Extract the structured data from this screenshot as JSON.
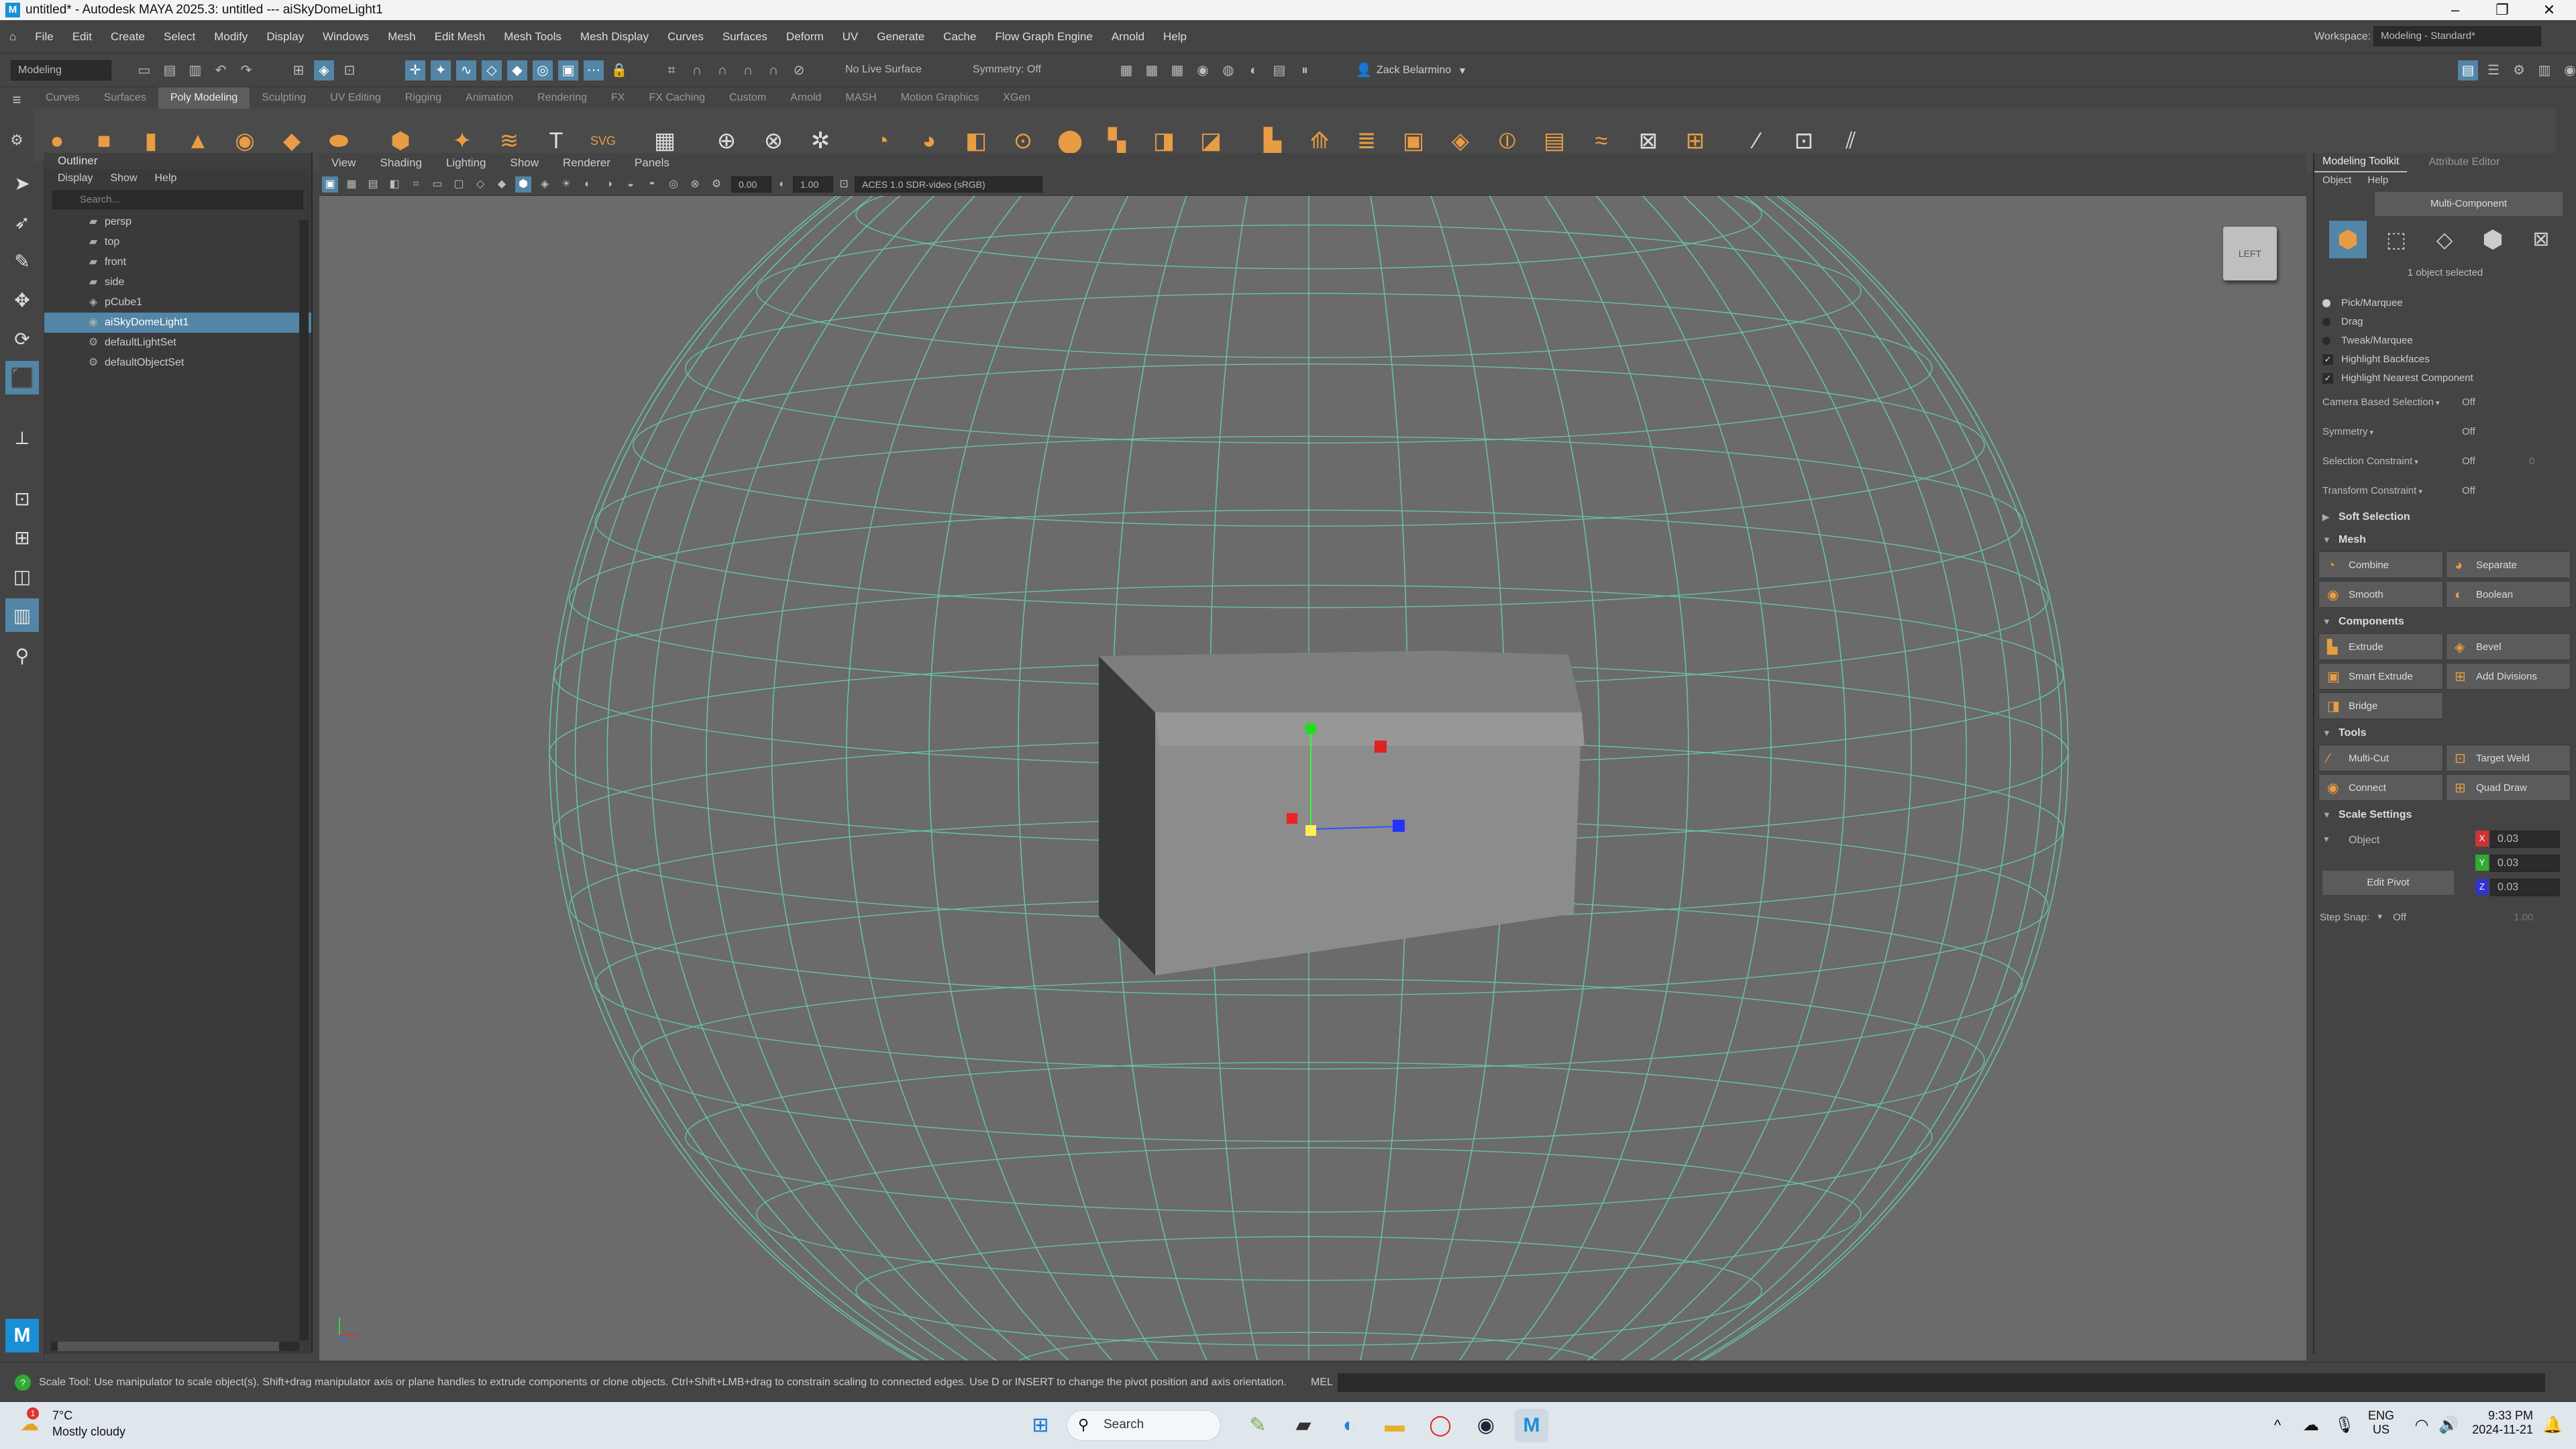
{
  "title": {
    "text": "untitled* - Autodesk MAYA 2025.3: untitled   ---   aiSkyDomeLight1",
    "logo_letter": "M",
    "min_icon": "minimize-icon",
    "max_icon": "maximize-icon",
    "close_icon": "close-icon"
  },
  "menubar": {
    "items": [
      "File",
      "Edit",
      "Create",
      "Select",
      "Modify",
      "Display",
      "Windows",
      "Mesh",
      "Edit Mesh",
      "Mesh Tools",
      "Mesh Display",
      "Curves",
      "Surfaces",
      "Deform",
      "UV",
      "Generate",
      "Cache",
      "Flow Graph Engine",
      "Arnold",
      "Help"
    ],
    "workspace_label": "Workspace:",
    "workspace_value": "Modeling - Standard*"
  },
  "statusline": {
    "mode": "Modeling",
    "live_surface": "No Live Surface",
    "symmetry": "Symmetry: Off",
    "user": "Zack Belarmino"
  },
  "shelf": {
    "tabs": [
      "Curves",
      "Surfaces",
      "Poly Modeling",
      "Sculpting",
      "UV Editing",
      "Rigging",
      "Animation",
      "Rendering",
      "FX",
      "FX Caching",
      "Custom",
      "Arnold",
      "MASH",
      "Motion Graphics",
      "XGen"
    ],
    "active_tab": "Poly Modeling"
  },
  "outliner": {
    "title": "Outliner",
    "menu": [
      "Display",
      "Show",
      "Help"
    ],
    "search_placeholder": "Search...",
    "items": [
      {
        "label": "persp",
        "icon": "camera-icon",
        "selected": false
      },
      {
        "label": "top",
        "icon": "camera-icon",
        "selected": false
      },
      {
        "label": "front",
        "icon": "camera-icon",
        "selected": false
      },
      {
        "label": "side",
        "icon": "camera-icon",
        "selected": false
      },
      {
        "label": "pCube1",
        "icon": "mesh-icon",
        "selected": false
      },
      {
        "label": "aiSkyDomeLight1",
        "icon": "light-icon",
        "selected": true
      },
      {
        "label": "defaultLightSet",
        "icon": "set-icon",
        "selected": false
      },
      {
        "label": "defaultObjectSet",
        "icon": "set-icon",
        "selected": false
      }
    ]
  },
  "viewport": {
    "menu": [
      "View",
      "Shading",
      "Lighting",
      "Show",
      "Renderer",
      "Panels"
    ],
    "exposure": "0.00",
    "gamma": "1.00",
    "colorspace": "ACES 1.0 SDR-video (sRGB)",
    "viewcube_label": "LEFT"
  },
  "modeling_toolkit": {
    "tabs": [
      "Modeling Toolkit",
      "Attribute Editor"
    ],
    "submenu": [
      "Object",
      "Help"
    ],
    "multi_component": "Multi-Component",
    "selected_count": "1 object selected",
    "select_modes": [
      "Pick/Marquee",
      "Drag",
      "Tweak/Marquee"
    ],
    "checks": [
      "Highlight Backfaces",
      "Highlight Nearest Component"
    ],
    "props": [
      {
        "label": "Camera Based Selection",
        "value": "Off"
      },
      {
        "label": "Symmetry",
        "value": "Off"
      },
      {
        "label": "Selection Constraint",
        "value": "Off",
        "extra": "0"
      },
      {
        "label": "Transform Constraint",
        "value": "Off"
      }
    ],
    "sections": {
      "soft_selection": "Soft Selection",
      "mesh": "Mesh",
      "components": "Components",
      "tools": "Tools",
      "scale_settings": "Scale Settings"
    },
    "mesh_buttons": [
      "Combine",
      "Separate",
      "Smooth",
      "Boolean"
    ],
    "component_buttons": [
      "Extrude",
      "Bevel",
      "Smart Extrude",
      "Add Divisions",
      "Bridge"
    ],
    "tool_buttons": [
      "Multi-Cut",
      "Target Weld",
      "Connect",
      "Quad Draw"
    ],
    "scale": {
      "space": "Object",
      "x": "0.03",
      "y": "0.03",
      "z": "0.03",
      "edit_pivot": "Edit Pivot",
      "step_snap_label": "Step Snap:",
      "step_snap_value": "Off",
      "step_snap_num": "1.00"
    }
  },
  "helpline": {
    "text": "Scale Tool: Use manipulator to scale object(s). Shift+drag manipulator axis or plane handles to extrude components or clone objects. Ctrl+Shift+LMB+drag to constrain scaling to connected edges. Use D or INSERT to change the pivot position and axis orientation.",
    "mel_label": "MEL"
  },
  "taskbar": {
    "weather_temp": "7°C",
    "weather_desc": "Mostly cloudy",
    "weather_badge": "1",
    "search": "Search",
    "lang": "ENG",
    "region": "US",
    "time": "9:33 PM",
    "date": "2024-11-21"
  },
  "colors": {
    "accent": "#5285a6",
    "shelf_icon": "#e89c44",
    "wire": "#66c2a5"
  }
}
